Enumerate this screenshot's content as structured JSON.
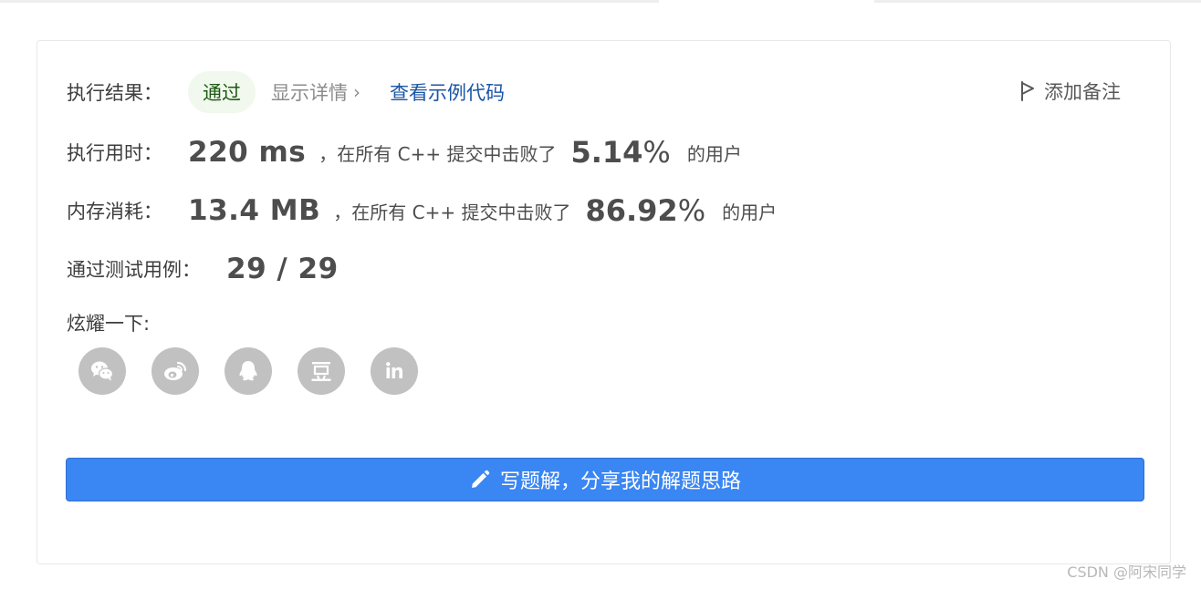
{
  "result": {
    "label": "执行结果：",
    "status": "通过",
    "details_link": "显示详情",
    "sample_code_link": "查看示例代码",
    "add_note": "添加备注"
  },
  "runtime": {
    "label": "执行用时：",
    "value": "220 ms",
    "compare_text": "，在所有 C++ 提交中击败了",
    "percent": "5.14",
    "percent_sign": "%",
    "users_text": "的用户"
  },
  "memory": {
    "label": "内存消耗：",
    "value": "13.4 MB",
    "compare_text": "，在所有 C++ 提交中击败了",
    "percent": "86.92",
    "percent_sign": "%",
    "users_text": "的用户"
  },
  "tests": {
    "label": "通过测试用例：",
    "value": "29 / 29"
  },
  "share": {
    "label": "炫耀一下:",
    "icons": [
      "wechat-icon",
      "weibo-icon",
      "qq-icon",
      "douban-icon",
      "linkedin-icon"
    ],
    "icon_color": "#c1c1c1"
  },
  "write_solution": {
    "label": "写题解，分享我的解题思路",
    "color": "#3a86f3"
  },
  "watermark": "CSDN @阿宋同学"
}
